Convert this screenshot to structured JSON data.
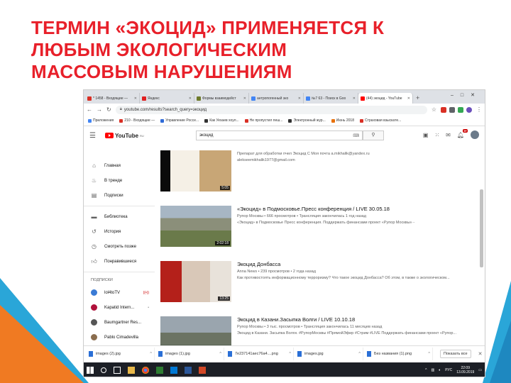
{
  "slide": {
    "title_line1": "ТЕРМИН «ЭКОЦИД» ПРИМЕНЯЕТСЯ К",
    "title_line2": "ЛЮБЫМ ЭКОЛОГИЧЕСКИМ",
    "title_line3": "МАССОВЫМ НАРУШЕНИЯМ"
  },
  "browser": {
    "tabs": [
      {
        "label": "* 1458 - Входящие —",
        "color": "#d93025"
      },
      {
        "label": "Яндекс",
        "color": "#e02020"
      },
      {
        "label": "Формы взаимодейст",
        "color": "#6e7a2a"
      },
      {
        "label": "антропогенный эко",
        "color": "#4285f4"
      },
      {
        "label": "№7 63 - Поиск в Goo",
        "color": "#4285f4"
      },
      {
        "label": "(44) экоцид - YouTube",
        "color": "#ff0000"
      }
    ],
    "url": "youtube.com/results?search_query=экоцид",
    "bookmarks": [
      {
        "label": "Приложения",
        "color": "#4285f4"
      },
      {
        "label": "210 - Входящие —",
        "color": "#d93025"
      },
      {
        "label": "Управление Россе...",
        "color": "#2f6bd8"
      },
      {
        "label": "Как Уехаев хоул...",
        "color": "#333333"
      },
      {
        "label": "Не пропустил пеш...",
        "color": "#d93025"
      },
      {
        "label": "Электронный жур...",
        "color": "#333333"
      },
      {
        "label": "Июнь 2018",
        "color": "#e8710a"
      },
      {
        "label": "Страховая взыскате...",
        "color": "#d93025"
      }
    ]
  },
  "youtube": {
    "logo": "YouTube",
    "logo_region": "RU",
    "search_value": "экоцид",
    "notifications": "9+",
    "nav": [
      {
        "label": "Главная",
        "icon": "home-icon"
      },
      {
        "label": "В тренде",
        "icon": "fire-icon"
      },
      {
        "label": "Подписки",
        "icon": "subscriptions-icon"
      }
    ],
    "library": [
      {
        "label": "Библиотека",
        "icon": "folder-icon"
      },
      {
        "label": "История",
        "icon": "history-icon"
      },
      {
        "label": "Смотреть позже",
        "icon": "clock-icon"
      },
      {
        "label": "Понравившиеся",
        "icon": "thumb-up-icon"
      }
    ],
    "subscriptions_heading": "ПОДПИСКИ",
    "subscriptions": [
      {
        "label": "lol4toTV",
        "badge": "((•))",
        "color": "#3a7bd5"
      },
      {
        "label": "Kapatid Intern...",
        "badge": "•",
        "color": "#b0123b"
      },
      {
        "label": "Baumgartner Res...",
        "badge": "",
        "color": "#555555"
      },
      {
        "label": "Pablo Cimadevilla",
        "badge": "",
        "color": "#8a6d4e"
      }
    ],
    "videos": [
      {
        "title": "",
        "meta": "Препарат для обработки пчел Экоцид С Моя почта a.mikhalik@yandex.ru",
        "desc": "alekseemikhalik1977@gmail.com",
        "duration": "5:05",
        "colors": [
          "#f5f0e6",
          "#c8a676"
        ]
      },
      {
        "title": "«Экоцид» в Подмосковье.Пресс конференция / LIVE 30.05.18",
        "meta": "Рупор Москвы • 666 просмотров • Трансляция закончилась 1 год назад",
        "desc": "«Экоцид» в Подмосковье Пресс конференция. Поддержать финансами проект «Рупор Москвы» -",
        "duration": "2:02:18",
        "colors": [
          "#a7b6c4",
          "#6a7a4a"
        ]
      },
      {
        "title": "Экоцид Донбасса",
        "meta": "Anna News • 239 просмотров • 2 года назад",
        "desc": "Как противостоять информационному терроризму? Что такое экоцид Донбасса? Об этом, в также о экологическом...",
        "duration": "13:25",
        "colors": [
          "#b4201a",
          "#d9c8b8"
        ]
      },
      {
        "title": "Экоцид в Казани.Засыпка Волги / LIVE 10.10.18",
        "meta": "Рупор Москвы • 3 тыс. просмотров • Трансляция закончилась 11 месяцев назад",
        "desc": "Экоцид в Казани. Засыпка Волги. #РупорМосквы #ПрямойЭфир #Стрим #LIVE Поддержать финансами проект «Рупор...",
        "duration": "",
        "colors": [
          "#9aa5ae",
          "#4a5a46"
        ]
      }
    ]
  },
  "downloads": {
    "files": [
      "images (2).jpg",
      "images (1).jpg",
      "7e237141aec76a4....png",
      "images.jpg",
      "Без названия (1).png"
    ],
    "show_all": "Показать все"
  },
  "taskbar": {
    "lang": "РУС",
    "time": "22:09",
    "date": "13.09.2019"
  }
}
